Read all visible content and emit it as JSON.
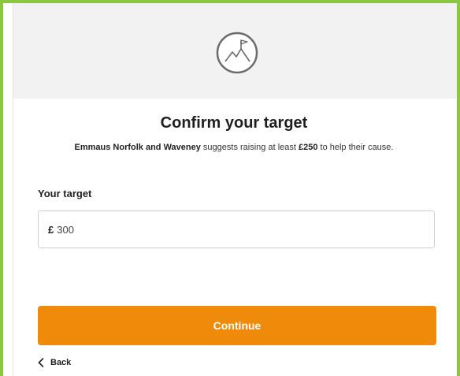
{
  "header": {
    "logo_icon": "fundraising-flag-mountain-icon"
  },
  "main": {
    "title": "Confirm your target",
    "subtitle": {
      "charity": "Emmaus Norfolk and Waveney",
      "text_before_amount": " suggests raising at least ",
      "amount": "£250",
      "text_after_amount": " to help their cause."
    },
    "target_label": "Your target",
    "target_input": {
      "currency": "£",
      "value": "300"
    },
    "continue_label": "Continue",
    "back_label": "Back"
  },
  "colors": {
    "frame": "#8dc63f",
    "header_bg": "#f2f2f2",
    "primary_button": "#f08a0b"
  }
}
